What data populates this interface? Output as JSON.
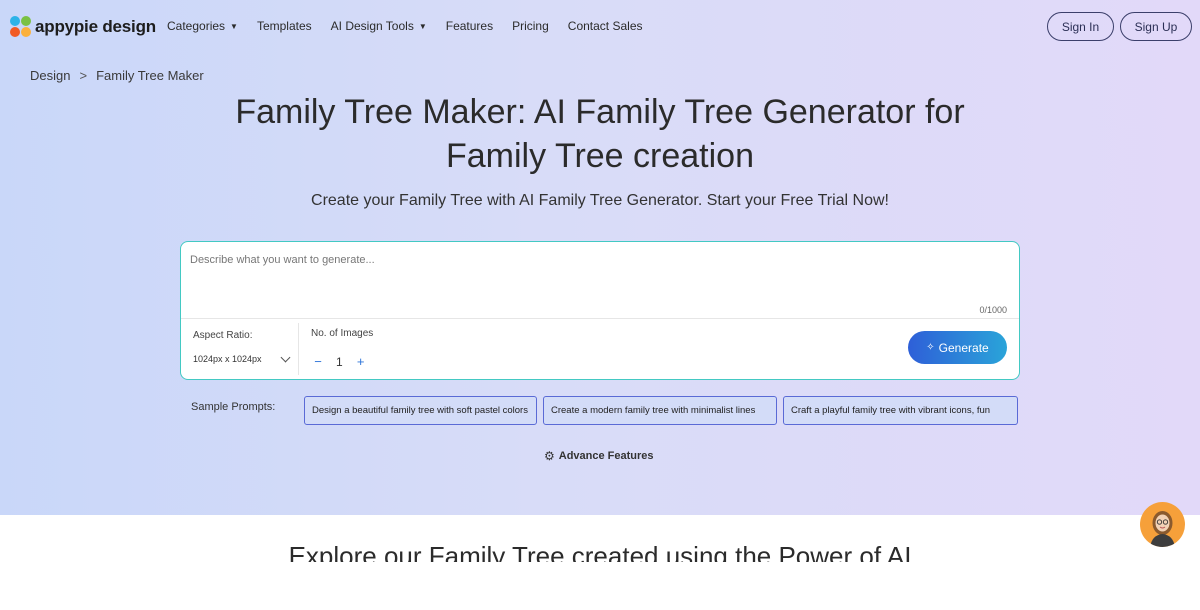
{
  "brand": {
    "name": "appypie design"
  },
  "nav": {
    "links": [
      {
        "label": "Categories",
        "dropdown": true
      },
      {
        "label": "Templates",
        "dropdown": false
      },
      {
        "label": "AI Design Tools",
        "dropdown": true
      },
      {
        "label": "Features",
        "dropdown": false
      },
      {
        "label": "Pricing",
        "dropdown": false
      },
      {
        "label": "Contact Sales",
        "dropdown": false
      }
    ],
    "sign_in": "Sign In",
    "sign_up": "Sign Up"
  },
  "breadcrumb": {
    "root": "Design",
    "separator": ">",
    "current": "Family Tree Maker"
  },
  "hero": {
    "title_line1": "Family Tree Maker: AI Family Tree Generator for",
    "title_line2": "Family Tree creation",
    "subtitle": "Create your Family Tree with AI Family Tree Generator. Start your Free Trial Now!"
  },
  "prompt": {
    "placeholder": "Describe what you want to generate...",
    "value": "",
    "counter": "0/1000",
    "aspect_label": "Aspect Ratio:",
    "aspect_value": "1024px x 1024px",
    "images_label": "No. of Images",
    "minus": "−",
    "images_value": "1",
    "plus": "+",
    "generate": "Generate"
  },
  "samples": {
    "label": "Sample Prompts:",
    "items": [
      "Design a beautiful family tree with soft pastel colors",
      "Create a modern family tree with minimalist lines",
      "Craft a playful family tree with vibrant icons, fun"
    ]
  },
  "advance": {
    "label": "Advance Features"
  },
  "explore": {
    "heading": "Explore our Family Tree created using the Power of AI"
  },
  "colors": {
    "accent": "#43c9c3",
    "button_start": "#2e5fd8",
    "button_end": "#2aa4d9",
    "avatar_bg": "#f6a03a"
  }
}
